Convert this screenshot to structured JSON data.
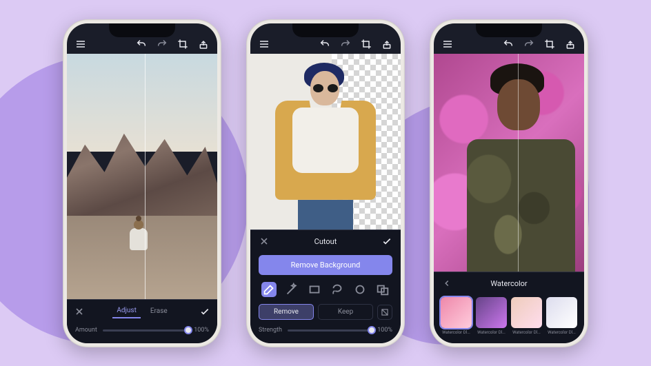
{
  "colors": {
    "accent": "#8486ec"
  },
  "topbar_icons": {
    "menu": "menu-icon",
    "undo": "undo-icon",
    "redo": "redo-icon",
    "crop": "crop-icon",
    "share": "share-icon"
  },
  "phone1": {
    "tabs": {
      "adjust": "Adjust",
      "erase": "Erase"
    },
    "slider_label": "Amount",
    "slider_value": "100%",
    "slider_position_pct": 100
  },
  "phone2": {
    "panel_title": "Cutout",
    "remove_bg": "Remove Background",
    "segments": {
      "remove": "Remove",
      "keep": "Keep"
    },
    "slider_label": "Strength",
    "slider_value": "100%",
    "slider_position_pct": 100,
    "tools": [
      "brush",
      "wand",
      "rect",
      "lasso",
      "ellipse",
      "subtract"
    ]
  },
  "phone3": {
    "panel_title": "Watercolor",
    "thumbs": [
      {
        "label": "Watercolor Dl..."
      },
      {
        "label": "Watercolor Dl..."
      },
      {
        "label": "Watercolor Dl..."
      },
      {
        "label": "Watercolor Dl..."
      }
    ]
  }
}
